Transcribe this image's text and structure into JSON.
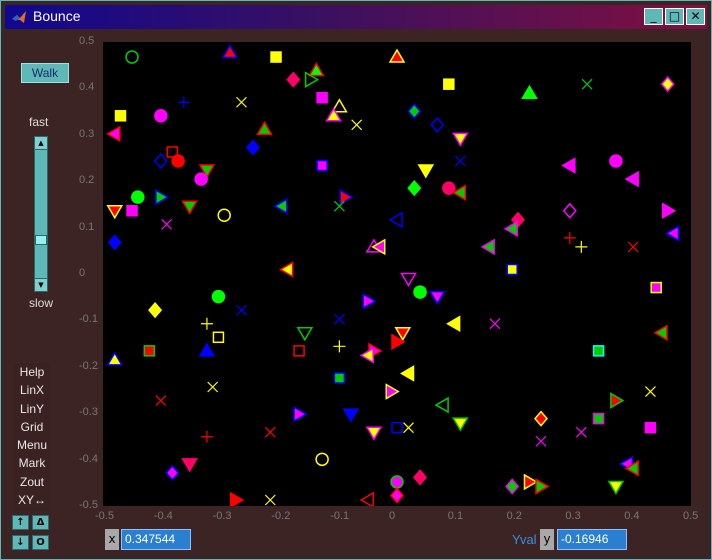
{
  "window": {
    "title": "Bounce",
    "minimize": "_",
    "maximize": "□",
    "close": "✕"
  },
  "controls": {
    "walk_label": "Walk",
    "fast_label": "fast",
    "slow_label": "slow",
    "speed_level": 0.72,
    "menu_items": [
      "Help",
      "LinX",
      "LinY",
      "Grid",
      "Menu",
      "Mark",
      "Zout",
      "XY↔"
    ],
    "small_buttons": {
      "up": "↑",
      "delta": "Δ",
      "down": "↓",
      "circle": "O"
    }
  },
  "readout": {
    "x_label": "x",
    "x_value": "0.347544",
    "yval_label": "Yval",
    "y_label": "y",
    "y_value": "-0.16946"
  },
  "axes": {
    "xticks": [
      "-0.5",
      "-0.4",
      "-0.3",
      "-0.2",
      "-0.1",
      "0",
      "0.1",
      "0.2",
      "0.3",
      "0.4",
      "0.5"
    ],
    "yticks": [
      "0.5",
      "0.4",
      "0.3",
      "0.2",
      "0.1",
      "0",
      "-0.1",
      "-0.2",
      "-0.3",
      "-0.4",
      "-0.5"
    ],
    "xlim": [
      -0.5,
      0.5
    ],
    "ylim": [
      -0.5,
      0.5
    ]
  },
  "chart_data": {
    "type": "scatter",
    "xlim": [
      -0.5,
      0.5
    ],
    "ylim": [
      -0.5,
      0.5
    ],
    "grid": false,
    "background": "#000000",
    "points": [
      {
        "x": -0.46,
        "y": 0.48,
        "m": "o",
        "c": "#00cc00",
        "f": false
      },
      {
        "x": -0.29,
        "y": 0.49,
        "m": "^",
        "c": "#ff0000",
        "f": true,
        "e": "#0000ff"
      },
      {
        "x": -0.21,
        "y": 0.48,
        "m": "s",
        "c": "#ffff00",
        "f": true
      },
      {
        "x": -0.14,
        "y": 0.45,
        "m": "^",
        "c": "#00ff00",
        "f": true,
        "e": "#ff0000"
      },
      {
        "x": 0.0,
        "y": 0.48,
        "m": "^",
        "c": "#ff0000",
        "f": true,
        "e": "#ffff00"
      },
      {
        "x": 0.09,
        "y": 0.42,
        "m": "s",
        "c": "#ffff00",
        "f": true
      },
      {
        "x": 0.33,
        "y": 0.42,
        "m": "x",
        "c": "#00cc00"
      },
      {
        "x": 0.47,
        "y": 0.42,
        "m": "d",
        "c": "#ffff00",
        "f": true,
        "e": "#ff00ff"
      },
      {
        "x": 0.23,
        "y": 0.4,
        "m": "^",
        "c": "#00ff00",
        "f": true
      },
      {
        "x": -0.18,
        "y": 0.43,
        "m": "d",
        "c": "#ff0066",
        "f": true
      },
      {
        "x": -0.15,
        "y": 0.43,
        "m": ">",
        "c": "#00cc00",
        "f": false
      },
      {
        "x": -0.37,
        "y": 0.38,
        "m": "+",
        "c": "#0000ff"
      },
      {
        "x": -0.27,
        "y": 0.38,
        "m": "x",
        "c": "#ffff00"
      },
      {
        "x": -0.13,
        "y": 0.39,
        "m": "s",
        "c": "#ff00ff",
        "f": true
      },
      {
        "x": -0.1,
        "y": 0.37,
        "m": "^",
        "c": "#ffff00",
        "f": false
      },
      {
        "x": -0.11,
        "y": 0.35,
        "m": "^",
        "c": "#ffff00",
        "f": true,
        "e": "#ff00ff"
      },
      {
        "x": -0.07,
        "y": 0.33,
        "m": "x",
        "c": "#ffff00"
      },
      {
        "x": -0.48,
        "y": 0.35,
        "m": "s",
        "c": "#ffff00",
        "f": true
      },
      {
        "x": -0.41,
        "y": 0.35,
        "m": "o",
        "c": "#ff00ff",
        "f": true
      },
      {
        "x": 0.03,
        "y": 0.36,
        "m": "d",
        "c": "#00cc00",
        "f": true,
        "e": "#0000ff"
      },
      {
        "x": 0.07,
        "y": 0.33,
        "m": "d",
        "c": "#0000ff",
        "f": false
      },
      {
        "x": -0.23,
        "y": 0.32,
        "m": "^",
        "c": "#00cc00",
        "f": true,
        "e": "#ff0000"
      },
      {
        "x": 0.11,
        "y": 0.3,
        "m": "v",
        "c": "#ffff00",
        "f": true,
        "e": "#ff00ff"
      },
      {
        "x": -0.49,
        "y": 0.31,
        "m": "<",
        "c": "#ff00ff",
        "f": true,
        "e": "#ff0000"
      },
      {
        "x": -0.39,
        "y": 0.27,
        "m": "s",
        "c": "#ff0000",
        "f": false
      },
      {
        "x": -0.41,
        "y": 0.25,
        "m": "d",
        "c": "#0000ff",
        "f": false
      },
      {
        "x": -0.38,
        "y": 0.25,
        "m": "o",
        "c": "#ff0000",
        "f": true
      },
      {
        "x": -0.25,
        "y": 0.28,
        "m": "d",
        "c": "#0000ff",
        "f": true
      },
      {
        "x": -0.33,
        "y": 0.23,
        "m": "v",
        "c": "#00cc00",
        "f": true,
        "e": "#ff0000"
      },
      {
        "x": -0.34,
        "y": 0.21,
        "m": "o",
        "c": "#ff00ff",
        "f": true
      },
      {
        "x": -0.13,
        "y": 0.24,
        "m": "s",
        "c": "#ff00ff",
        "f": true,
        "e": "#0000ff"
      },
      {
        "x": 0.11,
        "y": 0.25,
        "m": "x",
        "c": "#0000ff"
      },
      {
        "x": 0.38,
        "y": 0.25,
        "m": "o",
        "c": "#ff00ff",
        "f": true
      },
      {
        "x": 0.3,
        "y": 0.24,
        "m": "<",
        "c": "#ff00ff",
        "f": true
      },
      {
        "x": 0.05,
        "y": 0.23,
        "m": "v",
        "c": "#ffff00",
        "f": true
      },
      {
        "x": 0.41,
        "y": 0.21,
        "m": "<",
        "c": "#ff00ff",
        "f": true
      },
      {
        "x": 0.03,
        "y": 0.19,
        "m": "d",
        "c": "#00ff00",
        "f": true
      },
      {
        "x": 0.09,
        "y": 0.19,
        "m": "o",
        "c": "#ff0066",
        "f": true
      },
      {
        "x": 0.11,
        "y": 0.18,
        "m": "<",
        "c": "#00cc00",
        "f": true,
        "e": "#ff0000"
      },
      {
        "x": -0.45,
        "y": 0.17,
        "m": "o",
        "c": "#00ff00",
        "f": true
      },
      {
        "x": -0.41,
        "y": 0.17,
        "m": ">",
        "c": "#00cc00",
        "f": true,
        "e": "#0000ff"
      },
      {
        "x": -0.09,
        "y": 0.17,
        "m": ">",
        "c": "#ff0000",
        "f": true,
        "e": "#0000ff"
      },
      {
        "x": -0.36,
        "y": 0.15,
        "m": "v",
        "c": "#00cc00",
        "f": true,
        "e": "#ff0000"
      },
      {
        "x": -0.49,
        "y": 0.14,
        "m": "v",
        "c": "#ff0000",
        "f": true,
        "e": "#ffff00"
      },
      {
        "x": -0.46,
        "y": 0.14,
        "m": "s",
        "c": "#ff00ff",
        "f": true
      },
      {
        "x": -0.3,
        "y": 0.13,
        "m": "o",
        "c": "#ff0000",
        "f": false,
        "e": "#ffff00"
      },
      {
        "x": -0.2,
        "y": 0.15,
        "m": "<",
        "c": "#00cc00",
        "f": true,
        "e": "#0000ff"
      },
      {
        "x": -0.1,
        "y": 0.15,
        "m": "x",
        "c": "#00cc00"
      },
      {
        "x": 0.3,
        "y": 0.14,
        "m": "d",
        "c": "#ff00ff",
        "f": false
      },
      {
        "x": 0.47,
        "y": 0.14,
        "m": ">",
        "c": "#ff00ff",
        "f": true
      },
      {
        "x": -0.4,
        "y": 0.11,
        "m": "x",
        "c": "#ff00ff"
      },
      {
        "x": 0.0,
        "y": 0.12,
        "m": "<",
        "c": "#0000ff",
        "f": false
      },
      {
        "x": 0.21,
        "y": 0.12,
        "m": "d",
        "c": "#ff0066",
        "f": true
      },
      {
        "x": 0.2,
        "y": 0.1,
        "m": "<",
        "c": "#00cc00",
        "f": true,
        "e": "#ff00ff"
      },
      {
        "x": 0.3,
        "y": 0.08,
        "m": "+",
        "c": "#ff0000"
      },
      {
        "x": 0.32,
        "y": 0.06,
        "m": "+",
        "c": "#ffff00"
      },
      {
        "x": 0.41,
        "y": 0.06,
        "m": "x",
        "c": "#ff0000"
      },
      {
        "x": 0.48,
        "y": 0.09,
        "m": "<",
        "c": "#ff00ff",
        "f": true,
        "e": "#0000ff"
      },
      {
        "x": -0.49,
        "y": 0.07,
        "m": "d",
        "c": "#0000ff",
        "f": true
      },
      {
        "x": -0.04,
        "y": 0.06,
        "m": "^",
        "c": "#0000ff",
        "f": false,
        "e": "#ff00ff"
      },
      {
        "x": -0.03,
        "y": 0.06,
        "m": "<",
        "c": "#ff00ff",
        "f": true,
        "e": "#ffff00"
      },
      {
        "x": 0.16,
        "y": 0.06,
        "m": "<",
        "c": "#00cc00",
        "f": true,
        "e": "#ff00ff"
      },
      {
        "x": -0.19,
        "y": 0.01,
        "m": "<",
        "c": "#ffff00",
        "f": true,
        "e": "#ff0000"
      },
      {
        "x": 0.02,
        "y": -0.01,
        "m": "v",
        "c": "#ff00ff",
        "f": false
      },
      {
        "x": 0.2,
        "y": 0.01,
        "m": "s",
        "c": "#ffff00",
        "f": true,
        "e": "#0000ff"
      },
      {
        "x": 0.45,
        "y": -0.03,
        "m": "s",
        "c": "#ff00ff",
        "f": true,
        "e": "#ffff00"
      },
      {
        "x": -0.31,
        "y": -0.05,
        "m": "o",
        "c": "#00ff00",
        "f": true
      },
      {
        "x": 0.04,
        "y": -0.04,
        "m": "o",
        "c": "#00ff00",
        "f": true
      },
      {
        "x": 0.07,
        "y": -0.05,
        "m": "v",
        "c": "#ff00ff",
        "f": true,
        "e": "#0000ff"
      },
      {
        "x": -0.05,
        "y": -0.06,
        "m": ">",
        "c": "#ff00ff",
        "f": true,
        "e": "#0000ff"
      },
      {
        "x": -0.42,
        "y": -0.08,
        "m": "d",
        "c": "#ffff00",
        "f": true
      },
      {
        "x": -0.27,
        "y": -0.08,
        "m": "x",
        "c": "#0000ff"
      },
      {
        "x": -0.1,
        "y": -0.1,
        "m": "x",
        "c": "#0000ff"
      },
      {
        "x": -0.33,
        "y": -0.11,
        "m": "+",
        "c": "#ffff00"
      },
      {
        "x": -0.31,
        "y": -0.14,
        "m": "s",
        "c": "#ffff00",
        "f": false
      },
      {
        "x": -0.16,
        "y": -0.13,
        "m": "v",
        "c": "#00cc00",
        "f": false
      },
      {
        "x": 0.1,
        "y": -0.11,
        "m": "<",
        "c": "#ffff00",
        "f": true
      },
      {
        "x": 0.17,
        "y": -0.11,
        "m": "x",
        "c": "#ff00ff"
      },
      {
        "x": 0.46,
        "y": -0.13,
        "m": "<",
        "c": "#00cc00",
        "f": true,
        "e": "#ff0000"
      },
      {
        "x": 0.01,
        "y": -0.13,
        "m": "v",
        "c": "#ff0000",
        "f": true,
        "e": "#ffff00"
      },
      {
        "x": 0.0,
        "y": -0.15,
        "m": ">",
        "c": "#ff0000",
        "f": true
      },
      {
        "x": -0.04,
        "y": -0.17,
        "m": ">",
        "c": "#ff00ff",
        "f": true,
        "e": "#ff0000"
      },
      {
        "x": -0.05,
        "y": -0.18,
        "m": "<",
        "c": "#ffff00",
        "f": true,
        "e": "#ff00ff"
      },
      {
        "x": -0.1,
        "y": -0.16,
        "m": "+",
        "c": "#ffff00"
      },
      {
        "x": -0.17,
        "y": -0.17,
        "m": "s",
        "c": "#ff0000",
        "f": false
      },
      {
        "x": -0.33,
        "y": -0.17,
        "m": "^",
        "c": "#0000ff",
        "f": true
      },
      {
        "x": -0.43,
        "y": -0.17,
        "m": "s",
        "c": "#ff0000",
        "f": true,
        "e": "#00cc00"
      },
      {
        "x": -0.49,
        "y": -0.19,
        "m": "^",
        "c": "#ffff00",
        "f": true,
        "e": "#0000ff"
      },
      {
        "x": 0.35,
        "y": -0.17,
        "m": "s",
        "c": "#00cc00",
        "f": true,
        "e": "#00ffff"
      },
      {
        "x": 0.02,
        "y": -0.22,
        "m": "<",
        "c": "#ffff00",
        "f": true
      },
      {
        "x": -0.1,
        "y": -0.23,
        "m": "s",
        "c": "#00cc00",
        "f": true,
        "e": "#0000ff"
      },
      {
        "x": -0.41,
        "y": -0.28,
        "m": "x",
        "c": "#ff0000"
      },
      {
        "x": -0.32,
        "y": -0.25,
        "m": "x",
        "c": "#ffff00"
      },
      {
        "x": -0.01,
        "y": -0.26,
        "m": ">",
        "c": "#ff00ff",
        "f": true,
        "e": "#ffff00"
      },
      {
        "x": 0.08,
        "y": -0.29,
        "m": "<",
        "c": "#0000ff",
        "f": false,
        "e": "#00cc00"
      },
      {
        "x": 0.38,
        "y": -0.28,
        "m": ">",
        "c": "#ff0000",
        "f": true,
        "e": "#00cc00"
      },
      {
        "x": 0.44,
        "y": -0.26,
        "m": "x",
        "c": "#ffff00"
      },
      {
        "x": -0.17,
        "y": -0.31,
        "m": ">",
        "c": "#ff00ff",
        "f": true,
        "e": "#0000ff"
      },
      {
        "x": -0.08,
        "y": -0.31,
        "m": "v",
        "c": "#0000ff",
        "f": true
      },
      {
        "x": 0.11,
        "y": -0.33,
        "m": "v",
        "c": "#ffff00",
        "f": true,
        "e": "#00cc00"
      },
      {
        "x": 0.25,
        "y": -0.32,
        "m": "d",
        "c": "#ff0000",
        "f": true,
        "e": "#ffff00"
      },
      {
        "x": 0.35,
        "y": -0.32,
        "m": "s",
        "c": "#00cc00",
        "f": true,
        "e": "#ff00ff"
      },
      {
        "x": 0.44,
        "y": -0.34,
        "m": "s",
        "c": "#ff00ff",
        "f": true
      },
      {
        "x": -0.33,
        "y": -0.36,
        "m": "+",
        "c": "#ff0000"
      },
      {
        "x": -0.22,
        "y": -0.35,
        "m": "x",
        "c": "#ff0000"
      },
      {
        "x": -0.04,
        "y": -0.35,
        "m": "v",
        "c": "#ffff00",
        "f": true,
        "e": "#ff00ff"
      },
      {
        "x": 0.0,
        "y": -0.34,
        "m": "s",
        "c": "#0000ff",
        "f": false
      },
      {
        "x": 0.02,
        "y": -0.34,
        "m": "x",
        "c": "#ffff00"
      },
      {
        "x": 0.25,
        "y": -0.37,
        "m": "x",
        "c": "#ff00ff"
      },
      {
        "x": 0.32,
        "y": -0.35,
        "m": "x",
        "c": "#ff00ff"
      },
      {
        "x": -0.36,
        "y": -0.42,
        "m": "v",
        "c": "#ff0066",
        "f": true
      },
      {
        "x": -0.13,
        "y": -0.41,
        "m": "o",
        "c": "#ffff00",
        "f": false
      },
      {
        "x": 0.4,
        "y": -0.42,
        "m": "<",
        "c": "#ff00ff",
        "f": true,
        "e": "#0000ff"
      },
      {
        "x": 0.41,
        "y": -0.43,
        "m": "<",
        "c": "#00cc00",
        "f": true,
        "e": "#ff0000"
      },
      {
        "x": -0.39,
        "y": -0.44,
        "m": "d",
        "c": "#ff00ff",
        "f": true,
        "e": "#0000ff"
      },
      {
        "x": 0.0,
        "y": -0.46,
        "m": "o",
        "c": "#ff00ff",
        "f": true,
        "e": "#00cc00"
      },
      {
        "x": 0.04,
        "y": -0.45,
        "m": "d",
        "c": "#ff0066",
        "f": true
      },
      {
        "x": 0.2,
        "y": -0.47,
        "m": "d",
        "c": "#00cc00",
        "f": true,
        "e": "#ff00ff"
      },
      {
        "x": 0.23,
        "y": -0.46,
        "m": ">",
        "c": "#ff0000",
        "f": true,
        "e": "#ffff00"
      },
      {
        "x": 0.25,
        "y": -0.47,
        "m": ">",
        "c": "#00cc00",
        "f": true,
        "e": "#ff0000"
      },
      {
        "x": 0.38,
        "y": -0.47,
        "m": "v",
        "c": "#ffff00",
        "f": true,
        "e": "#00cc00"
      },
      {
        "x": -0.28,
        "y": -0.5,
        "m": ">",
        "c": "#ff0000",
        "f": true
      },
      {
        "x": -0.22,
        "y": -0.5,
        "m": "x",
        "c": "#ffff00"
      },
      {
        "x": -0.05,
        "y": -0.5,
        "m": "<",
        "c": "#ff0000",
        "f": false
      },
      {
        "x": 0.0,
        "y": -0.49,
        "m": "d",
        "c": "#ff00ff",
        "f": true,
        "e": "#ff0000"
      }
    ]
  }
}
